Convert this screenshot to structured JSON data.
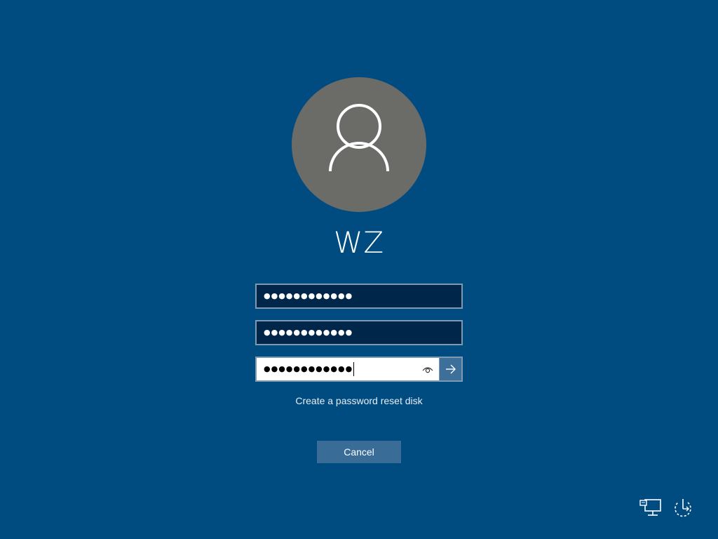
{
  "user": {
    "name": "WZ",
    "avatar_icon": "user-silhouette-icon"
  },
  "fields": [
    {
      "masked_value": "●●●●●●●●●●●●"
    },
    {
      "masked_value": "●●●●●●●●●●●●"
    },
    {
      "masked_value": "●●●●●●●●●●●●"
    }
  ],
  "links": {
    "reset_disk": "Create a password reset disk"
  },
  "buttons": {
    "cancel": "Cancel"
  },
  "icons": {
    "reveal": "eye-icon",
    "submit": "arrow-right-icon",
    "network": "network-icon",
    "power": "power-icon"
  },
  "colors": {
    "background": "#004b80",
    "avatar": "#6b6b68",
    "field_dark": "#00264a",
    "button": "#3a6c98"
  }
}
